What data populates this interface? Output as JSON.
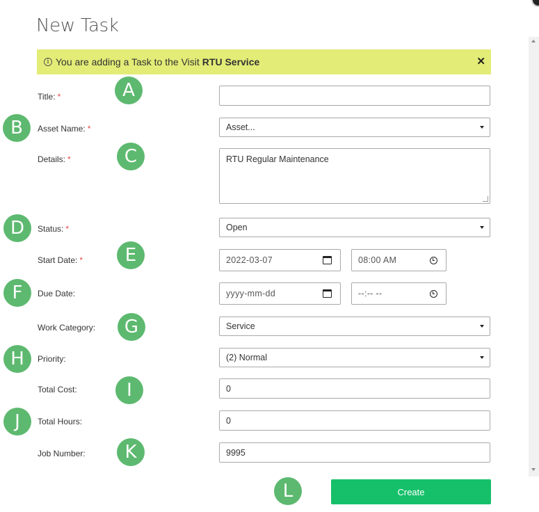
{
  "header": {
    "title": "New Task"
  },
  "banner": {
    "prefix": "You are adding a Task to the Visit",
    "visit_name": "RTU Service",
    "close_label": "✕"
  },
  "form": {
    "title": {
      "label": "Title:",
      "required": "*",
      "value": ""
    },
    "asset_name": {
      "label": "Asset Name:",
      "required": "*",
      "value": "Asset..."
    },
    "details": {
      "label": "Details:",
      "required": "*",
      "value": "RTU Regular Maintenance"
    },
    "status": {
      "label": "Status:",
      "required": "*",
      "value": "Open"
    },
    "start_date": {
      "label": "Start Date:",
      "required": "*",
      "date": "2022-03-07",
      "time": "08:00  AM"
    },
    "due_date": {
      "label": "Due Date:",
      "date_placeholder": "yyyy-mm-dd",
      "time_placeholder": "--:-- --"
    },
    "work_category": {
      "label": "Work Category:",
      "value": "Service"
    },
    "priority": {
      "label": "Priority:",
      "value": "(2) Normal"
    },
    "total_cost": {
      "label": "Total Cost:",
      "value": "0"
    },
    "total_hours": {
      "label": "Total Hours:",
      "value": "0"
    },
    "job_number": {
      "label": "Job Number:",
      "value": "9995"
    }
  },
  "actions": {
    "create_label": "Create"
  },
  "markers": [
    "A",
    "B",
    "C",
    "D",
    "E",
    "F",
    "G",
    "H",
    "I",
    "J",
    "K",
    "L"
  ],
  "colors": {
    "banner": "#e3ec76",
    "create_button": "#16c06a",
    "marker": "#5db96f",
    "required": "#e24a4a"
  }
}
